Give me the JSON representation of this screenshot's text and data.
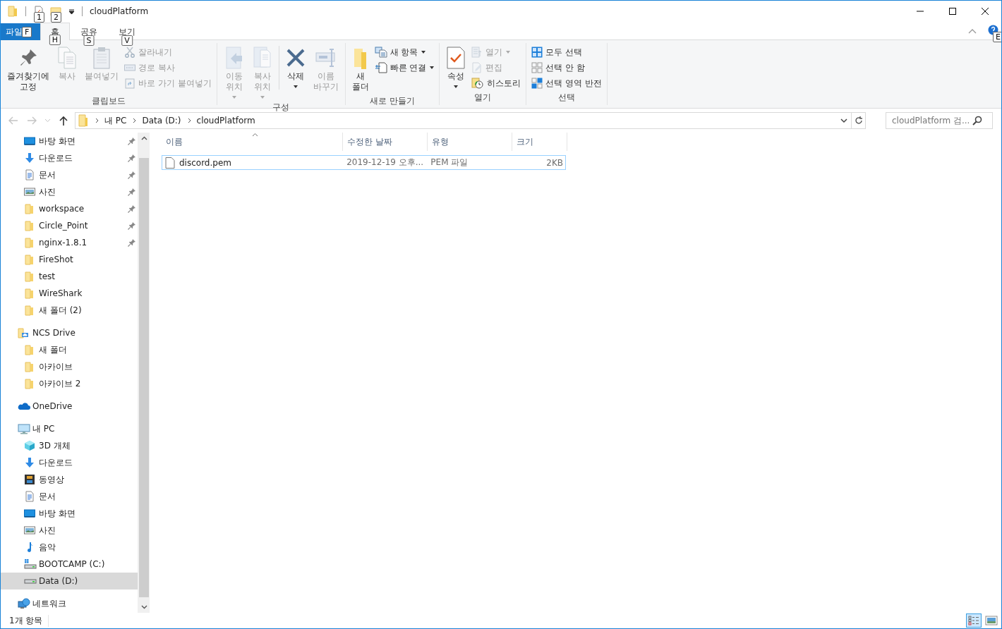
{
  "window": {
    "title": "cloudPlatform"
  },
  "quick_access_toolbar": [
    {
      "keytip": "1"
    },
    {
      "keytip": "2"
    }
  ],
  "tabs": [
    {
      "label": "파일",
      "keytip": "F",
      "kind": "file",
      "selected": false
    },
    {
      "label": "홈",
      "keytip": "H",
      "kind": "tab",
      "selected": true
    },
    {
      "label": "공유",
      "keytip": "S",
      "kind": "tab",
      "selected": false
    },
    {
      "label": "보기",
      "keytip": "V",
      "kind": "tab",
      "selected": false
    }
  ],
  "help": {
    "keytip": "E"
  },
  "ribbon": {
    "groups": [
      {
        "label": "클립보드",
        "items": [
          {
            "kind": "large",
            "lines": [
              "즐겨찾기에",
              "고정"
            ],
            "disabled": false,
            "dropdown": false
          },
          {
            "kind": "large",
            "lines": [
              "복사"
            ],
            "disabled": true,
            "dropdown": false
          },
          {
            "kind": "large",
            "lines": [
              "붙여넣기"
            ],
            "disabled": true,
            "dropdown": false
          },
          {
            "kind": "stack",
            "items": [
              {
                "label": "잘라내기",
                "disabled": true,
                "dropdown": false
              },
              {
                "label": "경로 복사",
                "disabled": true,
                "dropdown": false
              },
              {
                "label": "바로 가기 붙여넣기",
                "disabled": true,
                "dropdown": false
              }
            ]
          }
        ]
      },
      {
        "label": "구성",
        "items": [
          {
            "kind": "large",
            "lines": [
              "이동",
              "위치"
            ],
            "disabled": true,
            "dropdown": true
          },
          {
            "kind": "large",
            "lines": [
              "복사",
              "위치"
            ],
            "disabled": true,
            "dropdown": true
          },
          {
            "kind": "separator"
          },
          {
            "kind": "large",
            "lines": [
              "삭제"
            ],
            "disabled": false,
            "dropdown": true
          },
          {
            "kind": "large",
            "lines": [
              "이름",
              "바꾸기"
            ],
            "disabled": true,
            "dropdown": false
          }
        ]
      },
      {
        "label": "새로 만들기",
        "items": [
          {
            "kind": "large",
            "lines": [
              "새",
              "폴더"
            ],
            "disabled": false,
            "dropdown": false
          },
          {
            "kind": "stack",
            "items": [
              {
                "label": "새 항목",
                "disabled": false,
                "dropdown": true
              },
              {
                "label": "빠른 연결",
                "disabled": false,
                "dropdown": true
              }
            ]
          }
        ]
      },
      {
        "label": "열기",
        "items": [
          {
            "kind": "large",
            "lines": [
              "속성"
            ],
            "disabled": false,
            "dropdown": true
          },
          {
            "kind": "stack",
            "items": [
              {
                "label": "열기",
                "disabled": true,
                "dropdown": true
              },
              {
                "label": "편집",
                "disabled": true,
                "dropdown": false
              },
              {
                "label": "히스토리",
                "disabled": false,
                "dropdown": false
              }
            ]
          }
        ]
      },
      {
        "label": "선택",
        "items": [
          {
            "kind": "stack",
            "items": [
              {
                "label": "모두 선택",
                "disabled": false,
                "dropdown": false
              },
              {
                "label": "선택 안 함",
                "disabled": false,
                "dropdown": false
              },
              {
                "label": "선택 영역 반전",
                "disabled": false,
                "dropdown": false
              }
            ]
          }
        ]
      }
    ]
  },
  "address_bar": {
    "back_disabled": true,
    "forward_disabled": true,
    "breadcrumbs": [
      "내 PC",
      "Data (D:)",
      "cloudPlatform"
    ]
  },
  "search": {
    "placeholder": "cloudPlatform 검..."
  },
  "sidebar": {
    "sections": [
      {
        "items": [
          {
            "label": "바탕 화면",
            "kind": "desktop",
            "pinned": true,
            "selected": false
          },
          {
            "label": "다운로드",
            "kind": "download",
            "pinned": true,
            "selected": false
          },
          {
            "label": "문서",
            "kind": "documents",
            "pinned": true,
            "selected": false
          },
          {
            "label": "사진",
            "kind": "pictures",
            "pinned": true,
            "selected": false
          },
          {
            "label": "workspace",
            "kind": "folder",
            "pinned": true,
            "selected": false
          },
          {
            "label": "Circle_Point",
            "kind": "folder",
            "pinned": true,
            "selected": false
          },
          {
            "label": "nginx-1.8.1",
            "kind": "folder",
            "pinned": true,
            "selected": false
          },
          {
            "label": "FireShot",
            "kind": "folder",
            "pinned": false,
            "selected": false
          },
          {
            "label": "test",
            "kind": "folder",
            "pinned": false,
            "selected": false
          },
          {
            "label": "WireShark",
            "kind": "folder",
            "pinned": false,
            "selected": false
          },
          {
            "label": "새 폴더 (2)",
            "kind": "folder",
            "pinned": false,
            "selected": false
          }
        ]
      },
      {
        "root": {
          "label": "NCS Drive",
          "kind": "clouddrive",
          "selected": false
        },
        "items": [
          {
            "label": "새 폴더",
            "kind": "folder",
            "pinned": false,
            "selected": false
          },
          {
            "label": "아카이브",
            "kind": "folder",
            "pinned": false,
            "selected": false
          },
          {
            "label": "아카이브 2",
            "kind": "folder",
            "pinned": false,
            "selected": false
          }
        ]
      },
      {
        "root": {
          "label": "OneDrive",
          "kind": "cloud",
          "selected": false
        }
      },
      {
        "root": {
          "label": "내 PC",
          "kind": "pc",
          "selected": false
        },
        "items": [
          {
            "label": "3D 개체",
            "kind": "cube",
            "pinned": false,
            "selected": false
          },
          {
            "label": "다운로드",
            "kind": "download",
            "pinned": false,
            "selected": false
          },
          {
            "label": "동영상",
            "kind": "video",
            "pinned": false,
            "selected": false
          },
          {
            "label": "문서",
            "kind": "documents",
            "pinned": false,
            "selected": false
          },
          {
            "label": "바탕 화면",
            "kind": "desktop",
            "pinned": false,
            "selected": false
          },
          {
            "label": "사진",
            "kind": "pictures",
            "pinned": false,
            "selected": false
          },
          {
            "label": "음악",
            "kind": "music",
            "pinned": false,
            "selected": false
          },
          {
            "label": "BOOTCAMP (C:)",
            "kind": "windrive",
            "pinned": false,
            "selected": false
          },
          {
            "label": "Data (D:)",
            "kind": "drive",
            "pinned": false,
            "selected": true
          }
        ]
      },
      {
        "root": {
          "label": "네트워크",
          "kind": "network",
          "selected": false
        }
      }
    ]
  },
  "file_list": {
    "columns": [
      {
        "label": "이름",
        "sorted": true
      },
      {
        "label": "수정한 날짜",
        "sorted": false
      },
      {
        "label": "유형",
        "sorted": false
      },
      {
        "label": "크기",
        "sorted": false
      }
    ],
    "rows": [
      {
        "name": "discord.pem",
        "modified": "2019-12-19 오후...",
        "type": "PEM 파일",
        "size": "2KB",
        "focused": true,
        "selected": false
      }
    ]
  },
  "status_bar": {
    "item_count": "1개 항목",
    "views": [
      {
        "kind": "details",
        "selected": true
      },
      {
        "kind": "large_icons",
        "selected": false
      }
    ]
  }
}
